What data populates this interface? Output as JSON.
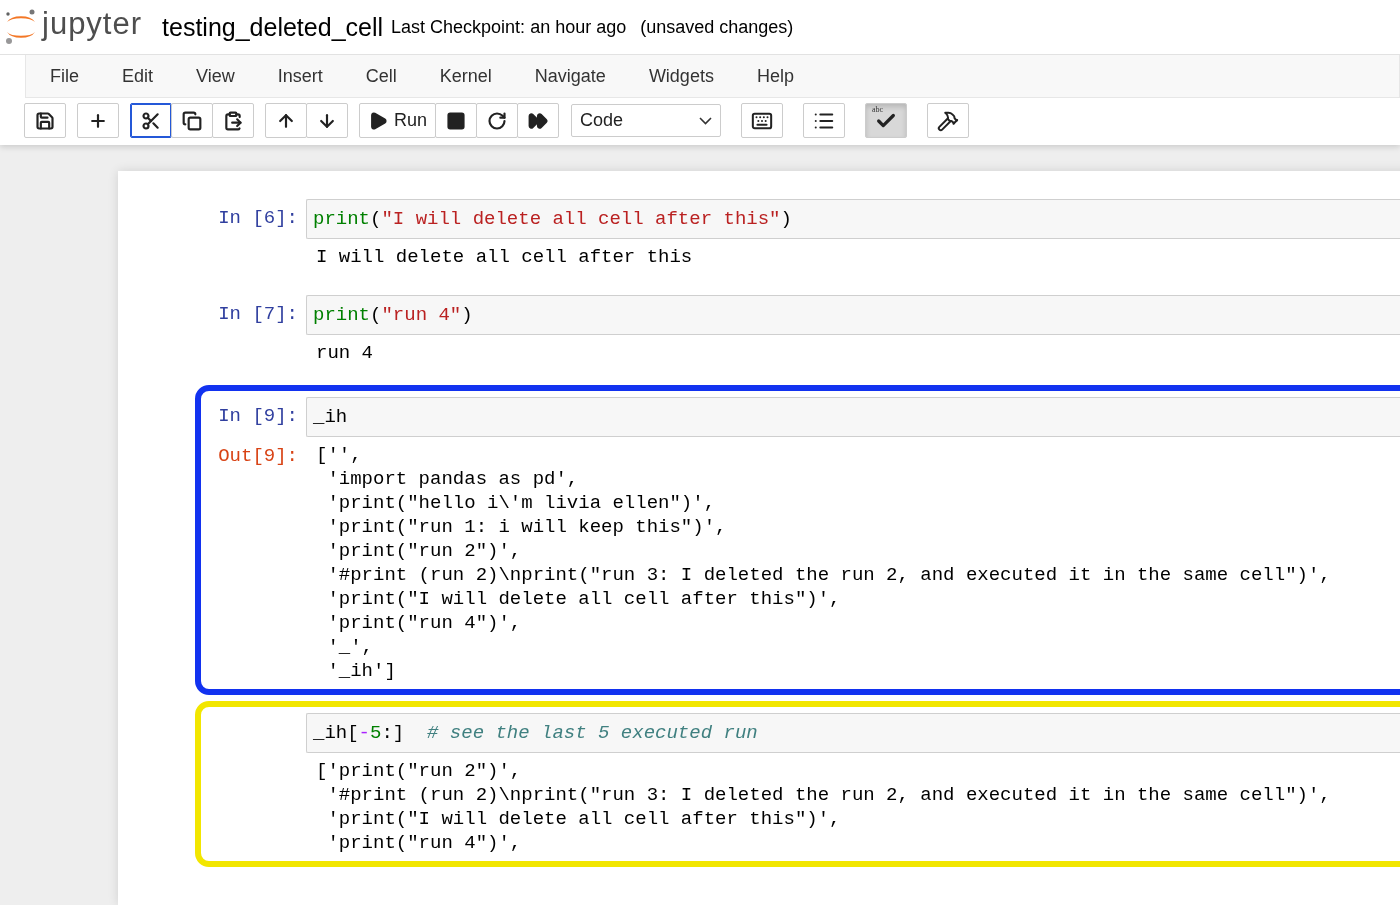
{
  "header": {
    "logo_text": "jupyter",
    "notebook_title": "testing_deleted_cell",
    "checkpoint": "Last Checkpoint: an hour ago",
    "status": "(unsaved changes)"
  },
  "menu": [
    "File",
    "Edit",
    "View",
    "Insert",
    "Cell",
    "Kernel",
    "Navigate",
    "Widgets",
    "Help"
  ],
  "toolbar": {
    "groups": [
      [
        {
          "focused": false,
          "pressed": false
        }
      ],
      [
        {
          "focused": false,
          "pressed": false
        }
      ],
      [
        {
          "focused": true,
          "pressed": false
        },
        {
          "focused": false,
          "pressed": false
        },
        {
          "focused": false,
          "pressed": false
        }
      ],
      [
        {
          "focused": false,
          "pressed": false
        },
        {
          "focused": false,
          "pressed": false
        }
      ],
      [
        {
          "focused": false,
          "pressed": false,
          "label": "Run"
        },
        {
          "focused": false,
          "pressed": false
        },
        {
          "focused": false,
          "pressed": false
        },
        {
          "focused": false,
          "pressed": false
        }
      ]
    ],
    "cell_type": "Code",
    "extra_buttons": [
      {
        "pressed": false
      },
      {
        "pressed": false
      },
      {
        "pressed": true,
        "label": "abc"
      },
      {
        "pressed": false
      }
    ]
  },
  "cells": [
    {
      "in_prompt": "In [6]:",
      "input": [
        {
          "kind": "builtin",
          "text": "print"
        },
        {
          "kind": "punct",
          "text": "("
        },
        {
          "kind": "string",
          "text": "\"I will delete all cell after this\""
        },
        {
          "kind": "punct",
          "text": ")"
        }
      ],
      "output": [
        "I will delete all cell after this"
      ]
    },
    {
      "in_prompt": "In [7]:",
      "input": [
        {
          "kind": "builtin",
          "text": "print"
        },
        {
          "kind": "punct",
          "text": "("
        },
        {
          "kind": "string",
          "text": "\"run 4\""
        },
        {
          "kind": "punct",
          "text": ")"
        }
      ],
      "output": [
        "run 4"
      ]
    },
    {
      "in_prompt": "In [9]:",
      "color": "#1232f0",
      "input": [
        {
          "kind": "punct",
          "text": "_ih"
        }
      ],
      "out_prompt": "Out[9]:",
      "output": [
        "['',",
        " 'import pandas as pd',",
        " 'print(\"hello i\\'m livia ellen\")',",
        " 'print(\"run 1: i will keep this\")',",
        " 'print(\"run 2\")',",
        " '#print (run 2)\\nprint(\"run 3: I deleted the run 2, and executed it in the same cell\")',",
        " 'print(\"I will delete all cell after this\")',",
        " 'print(\"run 4\")',",
        " '_',",
        " '_ih']"
      ]
    },
    {
      "color": "#f2e600",
      "input": [
        {
          "kind": "punct",
          "text": "_ih["
        },
        {
          "kind": "operator",
          "text": "-"
        },
        {
          "kind": "number",
          "text": "5"
        },
        {
          "kind": "punct",
          "text": ":]  "
        },
        {
          "kind": "comment",
          "text": "# see the last 5 executed run"
        }
      ],
      "output": [
        "['print(\"run 2\")',",
        " '#print (run 2)\\nprint(\"run 3: I deleted the run 2, and executed it in the same cell\")',",
        " 'print(\"I will delete all cell after this\")',",
        " 'print(\"run 4\")',"
      ]
    }
  ]
}
